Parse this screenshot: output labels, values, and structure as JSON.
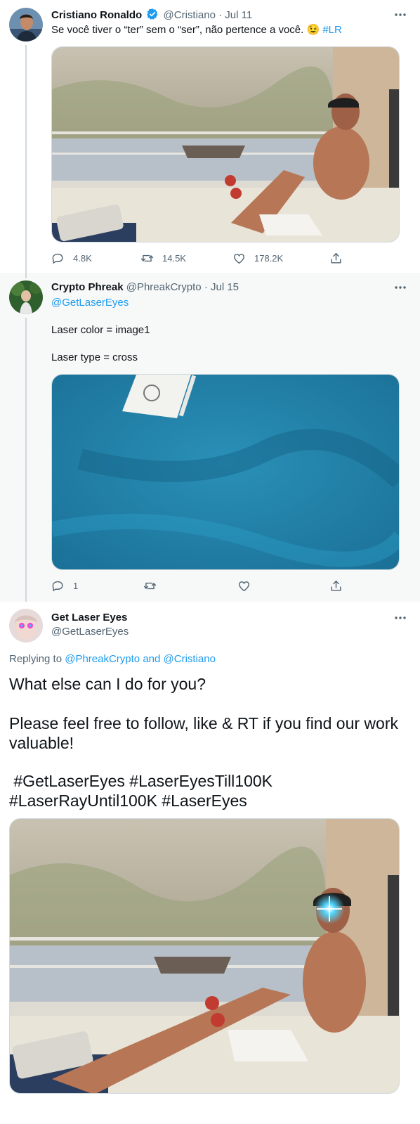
{
  "tweet1": {
    "name": "Cristiano Ronaldo",
    "handle": "@Cristiano",
    "separator": "·",
    "date": "Jul 11",
    "text": "Se você tiver o “ter” sem o “ser”, não pertence a você. 😉",
    "hashtag": "#LR",
    "replies": "4.8K",
    "retweets": "14.5K",
    "likes": "178.2K"
  },
  "tweet2": {
    "name": "Crypto Phreak",
    "handle": "@PhreakCrypto",
    "separator": "·",
    "date": "Jul 15",
    "mention": "@GetLaserEyes",
    "line1": "Laser color = image1",
    "line2": "Laser type = cross",
    "replies": "1"
  },
  "tweet3": {
    "name": "Get Laser Eyes",
    "handle": "@GetLaserEyes",
    "replying_prefix": "Replying to",
    "replying_to": "@PhreakCrypto and @Cristiano",
    "para1": "What else can I do for you?",
    "para2": "Please feel free to follow, like & RT if you find our work valuable!",
    "hashtags_line1": " #GetLaserEyes #LaserEyesTill100K",
    "hashtags_line2": "#LaserRayUntil100K #LaserEyes"
  },
  "colors": {
    "accent": "#1d9bf0",
    "secondary_text": "#536471",
    "reply_bg": "#f7f9f9"
  },
  "icons": [
    "verified-badge-icon",
    "more-icon",
    "reply-icon",
    "retweet-icon",
    "like-icon",
    "share-icon"
  ]
}
